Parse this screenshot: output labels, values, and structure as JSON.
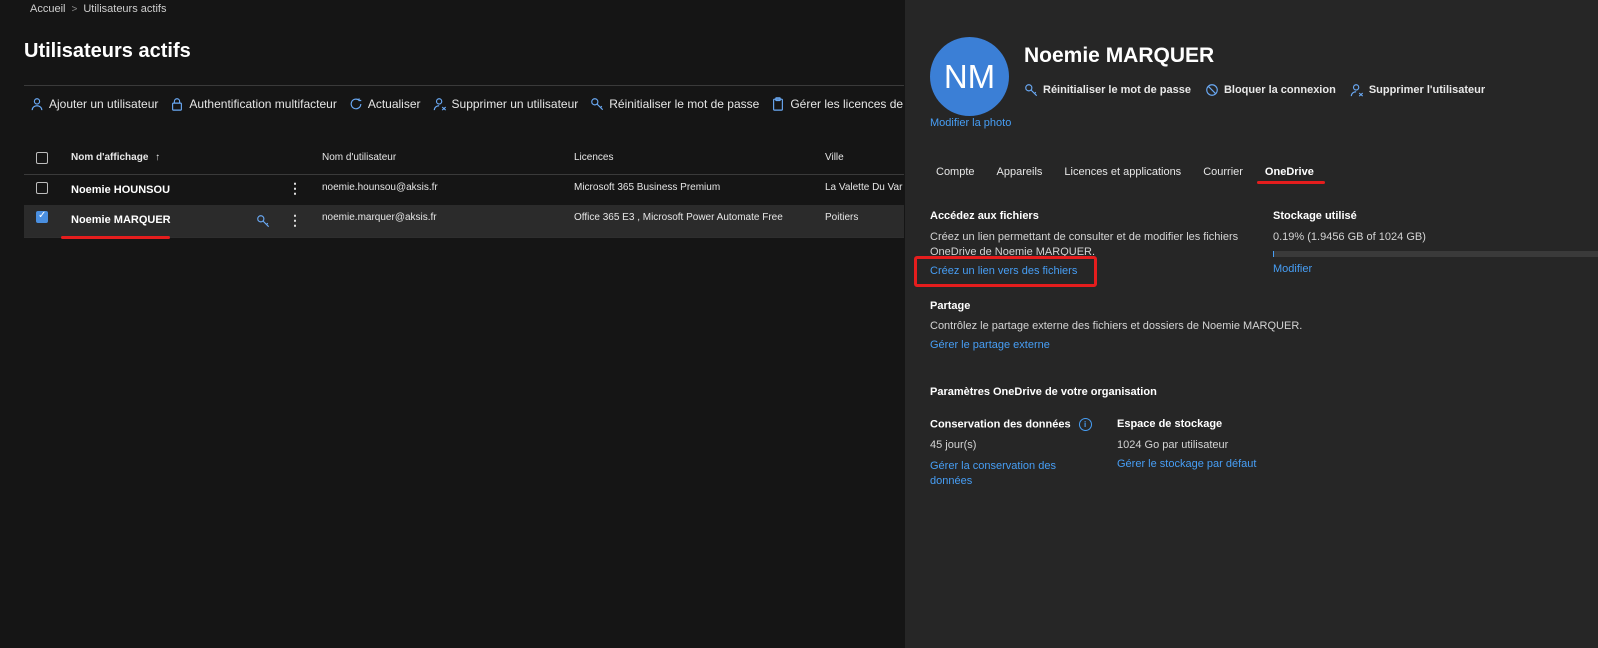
{
  "breadcrumb": {
    "home": "Accueil",
    "current": "Utilisateurs actifs"
  },
  "page_title": "Utilisateurs actifs",
  "toolbar": [
    {
      "label": "Ajouter un utilisateur",
      "icon": "add-user-icon"
    },
    {
      "label": "Authentification multifacteur",
      "icon": "lock-icon"
    },
    {
      "label": "Actualiser",
      "icon": "refresh-icon"
    },
    {
      "label": "Supprimer un utilisateur",
      "icon": "remove-user-icon"
    },
    {
      "label": "Réinitialiser le mot de passe",
      "icon": "key-icon"
    },
    {
      "label": "Gérer les licences de produits",
      "icon": "clipboard-icon"
    }
  ],
  "table": {
    "headers": {
      "display_name": "Nom d'affichage",
      "sort_indicator": "↑",
      "username": "Nom d'utilisateur",
      "licenses": "Licences",
      "city": "Ville"
    },
    "rows": [
      {
        "name": "Noemie HOUNSOU",
        "username": "noemie.hounsou@aksis.fr",
        "licenses": "Microsoft 365 Business Premium",
        "city": "La Valette Du Var",
        "selected": false
      },
      {
        "name": "Noemie MARQUER",
        "username": "noemie.marquer@aksis.fr",
        "licenses": "Office 365 E3 , Microsoft Power Automate Free",
        "city": "Poitiers",
        "selected": true
      }
    ]
  },
  "panel": {
    "avatar_initials": "NM",
    "name": "Noemie MARQUER",
    "modify_photo": "Modifier la photo",
    "actions": [
      {
        "label": "Réinitialiser le mot de passe",
        "icon": "key-icon"
      },
      {
        "label": "Bloquer la connexion",
        "icon": "block-icon"
      },
      {
        "label": "Supprimer l'utilisateur",
        "icon": "remove-user-icon"
      }
    ],
    "tabs": [
      "Compte",
      "Appareils",
      "Licences et applications",
      "Courrier",
      "OneDrive"
    ],
    "active_tab": "OneDrive",
    "access_files": {
      "title": "Accédez aux fichiers",
      "description_line1": "Créez un lien permettant de consulter et de modifier les fichiers",
      "description_line2": "OneDrive de Noemie MARQUER.",
      "link": "Créez un lien vers des fichiers"
    },
    "storage": {
      "title": "Stockage utilisé",
      "usage": "0.19% (1.9456 GB of 1024 GB)",
      "used_fraction": 0.0019,
      "link": "Modifier"
    },
    "sharing": {
      "title": "Partage",
      "description": "Contrôlez le partage externe des fichiers et dossiers de Noemie MARQUER.",
      "link": "Gérer le partage externe"
    },
    "org_settings": {
      "title": "Paramètres OneDrive de votre organisation",
      "retention_title": "Conservation des données",
      "retention_value": "45 jour(s)",
      "retention_link_line1": "Gérer la conservation des",
      "retention_link_line2": "données",
      "storage_title": "Espace de stockage",
      "storage_value": "1024 Go par utilisateur",
      "storage_link": "Gérer le stockage par défaut"
    }
  },
  "colors": {
    "accent": "#479ef5",
    "annotation_red": "#e51d1d",
    "avatar": "#3b7fd6"
  }
}
